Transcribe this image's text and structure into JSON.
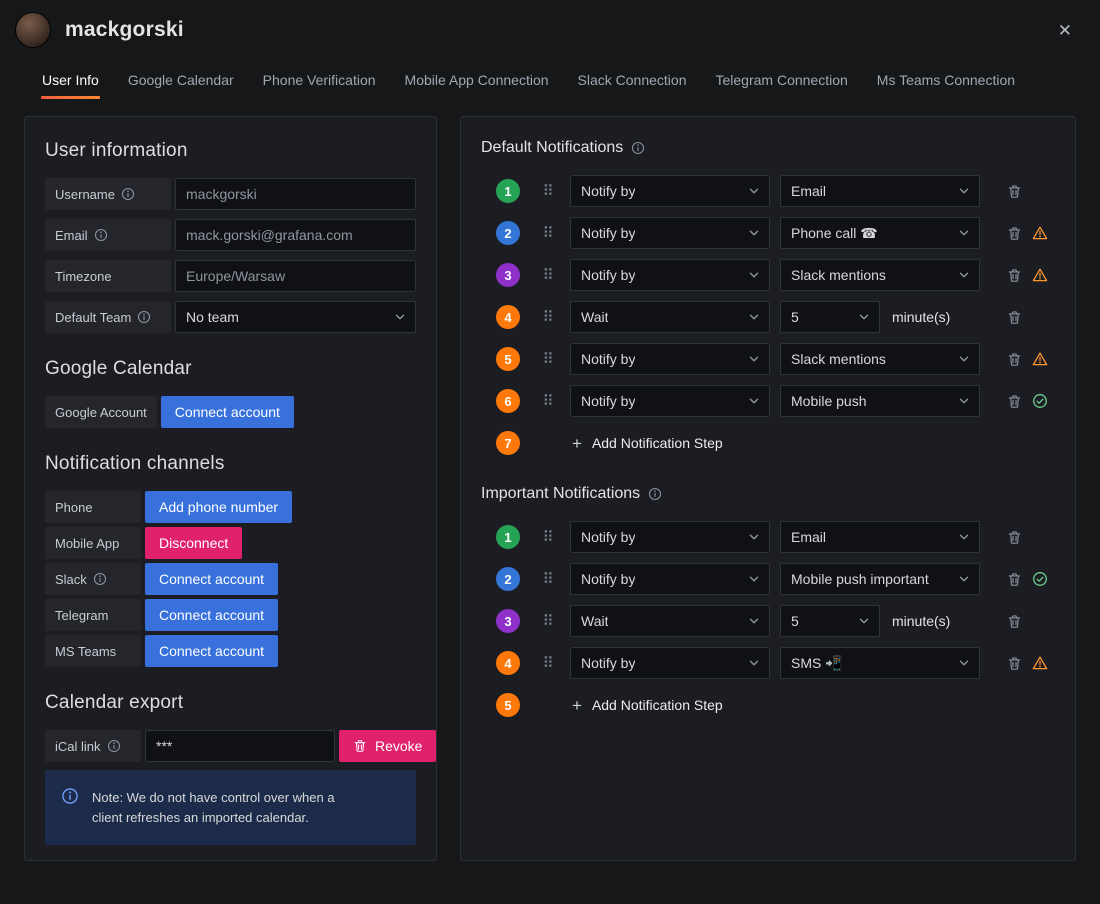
{
  "header": {
    "title": "mackgorski"
  },
  "icons": {
    "close": "✕",
    "drag_handle": "⠿",
    "plus": "+"
  },
  "tabs": [
    {
      "label": "User Info",
      "active": true
    },
    {
      "label": "Google Calendar",
      "active": false
    },
    {
      "label": "Phone Verification",
      "active": false
    },
    {
      "label": "Mobile App Connection",
      "active": false
    },
    {
      "label": "Slack Connection",
      "active": false
    },
    {
      "label": "Telegram Connection",
      "active": false
    },
    {
      "label": "Ms Teams Connection",
      "active": false
    }
  ],
  "user_info": {
    "heading": "User information",
    "fields": [
      {
        "label": "Username",
        "info": true,
        "value": "mackgorski",
        "type": "text"
      },
      {
        "label": "Email",
        "info": true,
        "value": "mack.gorski@grafana.com",
        "type": "text"
      },
      {
        "label": "Timezone",
        "info": false,
        "value": "Europe/Warsaw",
        "type": "text"
      },
      {
        "label": "Default Team",
        "info": true,
        "value": "No team",
        "type": "select"
      }
    ]
  },
  "google_calendar": {
    "heading": "Google Calendar",
    "row": {
      "label": "Google Account",
      "button": "Connect account",
      "style": "primary"
    }
  },
  "notification_channels": {
    "heading": "Notification channels",
    "rows": [
      {
        "label": "Phone",
        "info": false,
        "button": "Add phone number",
        "style": "primary"
      },
      {
        "label": "Mobile App",
        "info": false,
        "button": "Disconnect",
        "style": "destructive"
      },
      {
        "label": "Slack",
        "info": true,
        "button": "Connect account",
        "style": "primary"
      },
      {
        "label": "Telegram",
        "info": false,
        "button": "Connect account",
        "style": "primary"
      },
      {
        "label": "MS Teams",
        "info": false,
        "button": "Connect account",
        "style": "primary"
      }
    ]
  },
  "calendar_export": {
    "heading": "Calendar export",
    "label": "iCal link",
    "info": true,
    "value": "***",
    "revoke_button": "Revoke",
    "note": "Note: We do not have control over when a client refreshes an imported calendar."
  },
  "notifications": {
    "default": {
      "heading": "Default Notifications",
      "steps": [
        {
          "num": "1",
          "color": "green",
          "kind": "notify",
          "field1": "Notify by",
          "field2": "Email",
          "icons": [
            "trash"
          ]
        },
        {
          "num": "2",
          "color": "blue",
          "kind": "notify",
          "field1": "Notify by",
          "field2": "Phone call ☎",
          "icons": [
            "trash",
            "warning"
          ]
        },
        {
          "num": "3",
          "color": "purple",
          "kind": "notify",
          "field1": "Notify by",
          "field2": "Slack mentions",
          "icons": [
            "trash",
            "warning"
          ]
        },
        {
          "num": "4",
          "color": "orange",
          "kind": "wait",
          "field1": "Wait",
          "field2": "5",
          "suffix": "minute(s)",
          "icons": [
            "trash"
          ]
        },
        {
          "num": "5",
          "color": "orange",
          "kind": "notify",
          "field1": "Notify by",
          "field2": "Slack mentions",
          "icons": [
            "trash",
            "warning"
          ]
        },
        {
          "num": "6",
          "color": "orange",
          "kind": "notify",
          "field1": "Notify by",
          "field2": "Mobile push",
          "icons": [
            "trash",
            "success"
          ]
        },
        {
          "num": "7",
          "color": "orange",
          "kind": "add",
          "add_label": "Add Notification Step"
        }
      ]
    },
    "important": {
      "heading": "Important Notifications",
      "steps": [
        {
          "num": "1",
          "color": "green",
          "kind": "notify",
          "field1": "Notify by",
          "field2": "Email",
          "icons": [
            "trash"
          ]
        },
        {
          "num": "2",
          "color": "blue",
          "kind": "notify",
          "field1": "Notify by",
          "field2": "Mobile push important",
          "icons": [
            "trash",
            "success"
          ]
        },
        {
          "num": "3",
          "color": "purple",
          "kind": "wait",
          "field1": "Wait",
          "field2": "5",
          "suffix": "minute(s)",
          "icons": [
            "trash"
          ]
        },
        {
          "num": "4",
          "color": "orange",
          "kind": "notify",
          "field1": "Notify by",
          "field2": "SMS 📲",
          "icons": [
            "trash",
            "warning"
          ]
        },
        {
          "num": "5",
          "color": "orange",
          "kind": "add",
          "add_label": "Add Notification Step"
        }
      ]
    }
  },
  "colors": {
    "primary_blue": "#3871dc",
    "destructive_pink": "#e0226c",
    "tab_accent": "#ff8833",
    "warning_orange": "#ff9830",
    "success_green": "#6ccf8e",
    "info_blue": "#6e9fff",
    "badges": {
      "green": "#27a356",
      "blue": "#3376d8",
      "purple": "#8e30c9",
      "orange": "#ff780a"
    }
  }
}
